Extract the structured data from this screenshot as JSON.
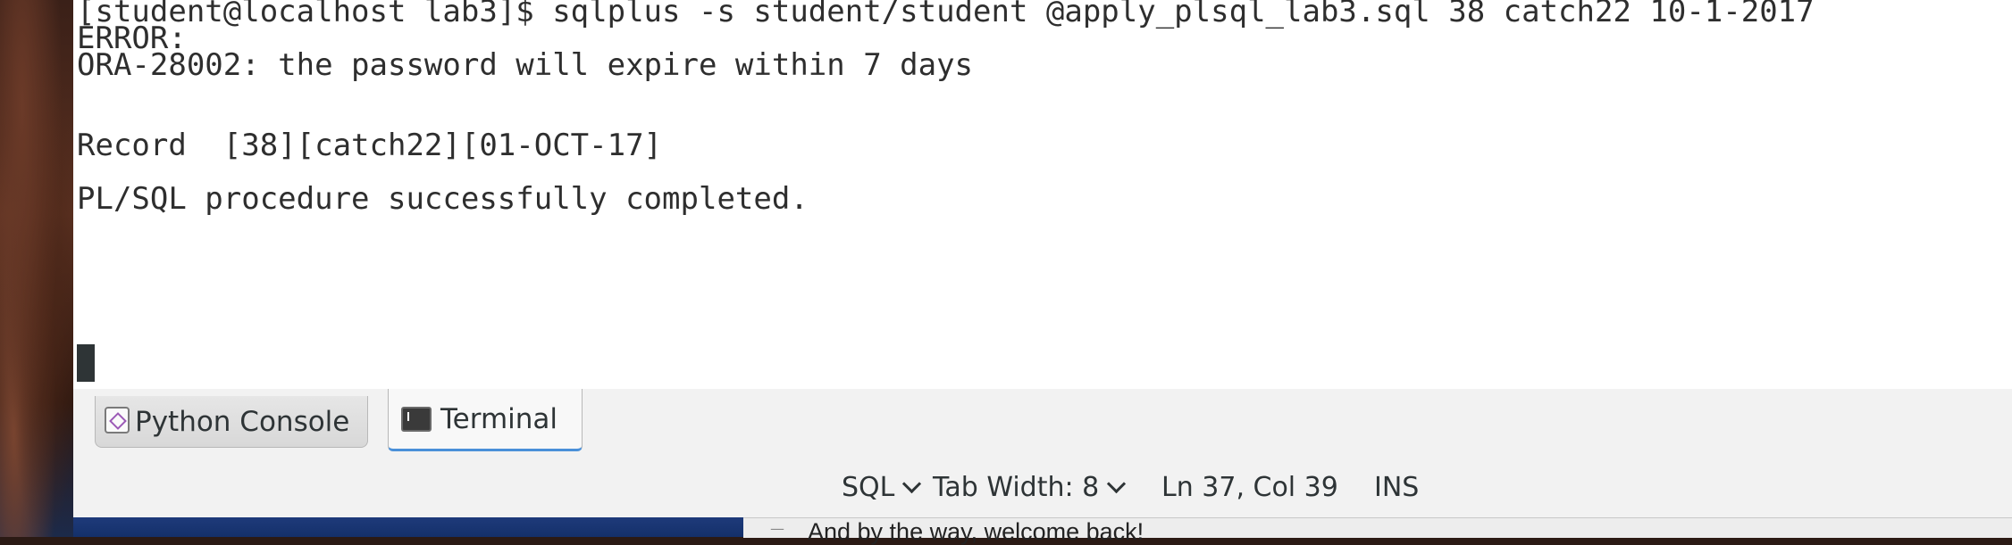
{
  "terminal": {
    "lines": [
      "[student@localhost lab3]$ sqlplus -s student/student @apply_plsql_lab3.sql 38 catch22 10-1-2017",
      "ERROR:",
      "ORA-28002: the password will expire within 7 days",
      "",
      "",
      "Record  [38][catch22][01-OCT-17]",
      "",
      "PL/SQL procedure successfully completed.",
      ""
    ]
  },
  "tabs": {
    "python_console": "Python Console",
    "terminal": "Terminal"
  },
  "statusbar": {
    "language": "SQL",
    "tab_width": "Tab Width: 8",
    "position": "Ln 37, Col 39",
    "mode": "INS"
  },
  "behind_window": {
    "text": "And by the way, welcome back!"
  },
  "colors": {
    "active_tab_underline": "#4a90d9",
    "terminal_background": "#ffffff",
    "terminal_text": "#2e2e2e"
  },
  "icons": {
    "python_console": "python-console-icon",
    "terminal": "terminal-icon"
  }
}
